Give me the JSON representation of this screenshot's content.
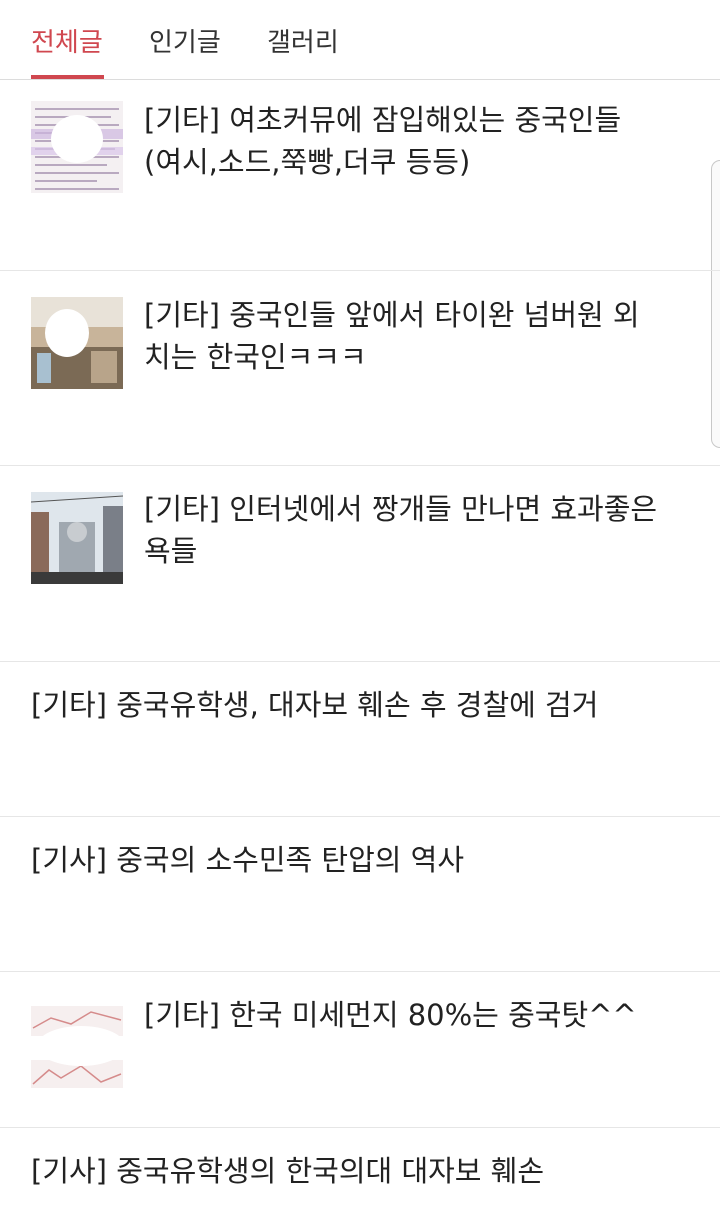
{
  "tabs": [
    {
      "label": "전체글",
      "active": true
    },
    {
      "label": "인기글",
      "active": false
    },
    {
      "label": "갤러리",
      "active": false
    }
  ],
  "colors": {
    "accent": "#d0474f",
    "divider": "#e6e6e6"
  },
  "posts": [
    {
      "title": "[기타] 여초커뮤에 잠입해있는 중국인들 (여시,소드,쭉빵,더쿠 등등)",
      "has_thumbnail": true,
      "thumbnail": "text-screenshot-thumbnail"
    },
    {
      "title": "[기타] 중국인들 앞에서 타이완 넘버원 외치는 한국인ㅋㅋㅋ",
      "has_thumbnail": true,
      "thumbnail": "street-photo-thumbnail"
    },
    {
      "title": "[기타] 인터넷에서 짱개들 만나면 효과좋은 욕들",
      "has_thumbnail": true,
      "thumbnail": "building-photo-thumbnail"
    },
    {
      "title": "[기타] 중국유학생, 대자보 훼손 후 경찰에 검거",
      "has_thumbnail": false
    },
    {
      "title": "[기사] 중국의 소수민족 탄압의 역사",
      "has_thumbnail": false
    },
    {
      "title": "[기타] 한국 미세먼지 80%는 중국탓^^",
      "has_thumbnail": true,
      "thumbnail": "map-thumbnail"
    },
    {
      "title": "[기사] 중국유학생의 한국의대 대자보 훼손",
      "has_thumbnail": false
    }
  ]
}
